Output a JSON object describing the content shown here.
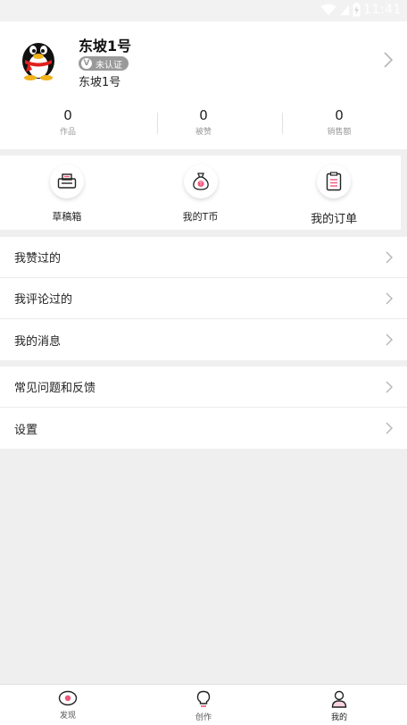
{
  "status": {
    "time": "11:41"
  },
  "profile": {
    "name": "东坡1号",
    "badge": "未认证",
    "badge_icon": "V",
    "subtitle": "东坡1号",
    "avatar_icon": "qq-penguin-avatar"
  },
  "stats": [
    {
      "value": "0",
      "label": "作品"
    },
    {
      "value": "0",
      "label": "被赞"
    },
    {
      "value": "0",
      "label": "销售额"
    }
  ],
  "quick": [
    {
      "label": "草稿箱",
      "icon": "printer-icon"
    },
    {
      "label": "我的T币",
      "icon": "money-bag-icon"
    },
    {
      "label": "我的订单",
      "icon": "order-list-icon"
    }
  ],
  "menu1": [
    {
      "label": "我赞过的"
    },
    {
      "label": "我评论过的"
    },
    {
      "label": "我的消息"
    }
  ],
  "menu2": [
    {
      "label": "常见问题和反馈"
    },
    {
      "label": "设置"
    }
  ],
  "tabs": [
    {
      "label": "发现",
      "icon": "eye-icon"
    },
    {
      "label": "创作",
      "icon": "lightbulb-icon"
    },
    {
      "label": "我的",
      "icon": "person-icon",
      "active": true
    }
  ],
  "colors": {
    "accent": "#f0567a",
    "background": "#efefef",
    "badge": "#9a9a9a"
  }
}
